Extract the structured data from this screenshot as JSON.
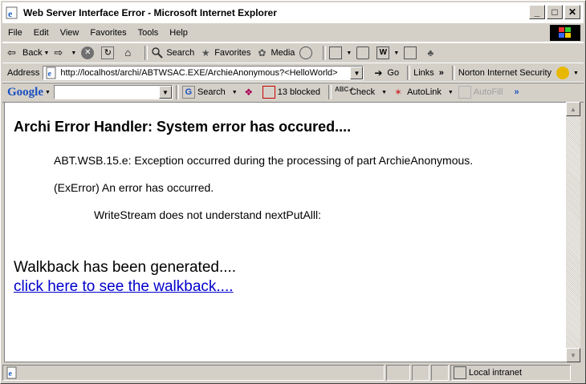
{
  "window": {
    "title": "Web Server Interface Error - Microsoft Internet Explorer",
    "buttons": {
      "minimize": "_",
      "maximize": "□",
      "close": "✕"
    }
  },
  "menu": [
    "File",
    "Edit",
    "View",
    "Favorites",
    "Tools",
    "Help"
  ],
  "toolbar": {
    "back": "Back",
    "search": "Search",
    "favorites": "Favorites",
    "media": "Media"
  },
  "address": {
    "label": "Address",
    "url": "http://localhost/archi/ABTWSAC.EXE/ArchieAnonymous?<HelloWorld>",
    "go": "Go",
    "links": "Links",
    "norton": "Norton Internet Security"
  },
  "google_bar": {
    "logo": "Google",
    "search": "Search",
    "blocked": "13 blocked",
    "check": "Check",
    "autolink": "AutoLink",
    "autofill": "AutoFill"
  },
  "page": {
    "heading": "Archi Error Handler: System error has occured....",
    "line1": "ABT.WSB.15.e: Exception occurred during the processing of part ArchieAnonymous.",
    "line2": "(ExError) An error has occurred.",
    "line3": "WriteStream does not understand nextPutAlll:",
    "walkback": "Walkback has been generated....",
    "walkback_link": "click here to see the walkback...."
  },
  "status": {
    "zone": "Local intranet"
  },
  "colors": {
    "chrome": "#d4d0c8",
    "link": "#0000cc"
  }
}
